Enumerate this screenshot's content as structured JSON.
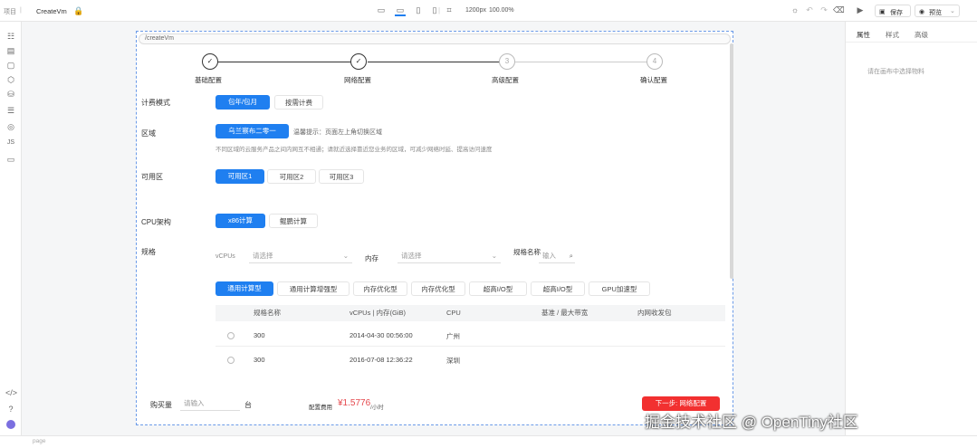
{
  "topbar": {
    "project": "项目",
    "page_name": "CreateVm",
    "canvas_size": "1200px",
    "zoom": "100.00%",
    "publish_label": "保存",
    "preview_label": "预览"
  },
  "canvas": {
    "title": "/createVm",
    "steps": [
      {
        "label": "基础配置",
        "state": "done"
      },
      {
        "label": "网络配置",
        "state": "done"
      },
      {
        "label": "高级配置",
        "state": "pending",
        "num": "3"
      },
      {
        "label": "确认配置",
        "state": "pending",
        "num": "4"
      }
    ],
    "billing": {
      "label": "计费模式",
      "options": [
        "包年/包月",
        "按需计费"
      ]
    },
    "region": {
      "label": "区域",
      "selected": "乌兰察布二零一",
      "hint": "温馨提示：页面左上角切换区域",
      "note": "不同区域的云服务产品之间内网互不相通；请就近选择靠近您业务的区域，可减少网络时延、提高访问速度"
    },
    "az": {
      "label": "可用区",
      "options": [
        "可用区1",
        "可用区2",
        "可用区3"
      ]
    },
    "cpu_arch": {
      "label": "CPU架构",
      "options": [
        "x86计算",
        "鲲鹏计算"
      ]
    },
    "spec": {
      "label": "规格",
      "vcpus_label": "vCPUs",
      "vcpus_placeholder": "请选择",
      "memory_label": "内存",
      "memory_placeholder": "请选择",
      "name_label": "规格名称",
      "name_placeholder": "输入",
      "tabs": [
        "通用计算型",
        "通用计算增强型",
        "内存优化型",
        "内存优化型",
        "超高I/O型",
        "超高I/O型",
        "GPU加速型"
      ]
    },
    "table": {
      "headers": [
        "规格名称",
        "vCPUs | 内存(GiB)",
        "CPU",
        "基准 / 最大带宽",
        "内网收发包"
      ],
      "rows": [
        [
          "300",
          "2014-04-30 00:56:00",
          "广州"
        ],
        [
          "300",
          "2016-07-08 12:36:22",
          "深圳"
        ]
      ]
    },
    "footer": {
      "qty_label": "购买量",
      "qty_placeholder": "请输入",
      "unit": "台",
      "fee_label": "配置费用",
      "price": "¥1.5776",
      "price_unit": "/小时",
      "next_button": "下一步: 网络配置"
    }
  },
  "rightpanel": {
    "tabs": [
      "属性",
      "样式",
      "高级"
    ],
    "empty_text": "请在画布中选择物料"
  },
  "statusbar": {
    "text": "page"
  },
  "watermark": "掘金技术社区 @ OpenTiny社区"
}
